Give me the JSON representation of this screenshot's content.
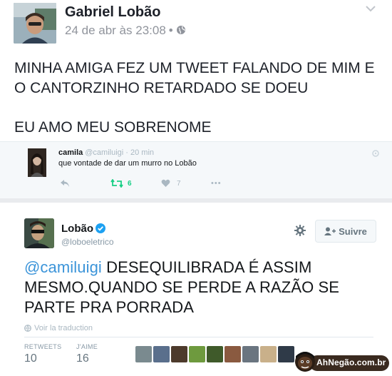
{
  "post": {
    "author": "Gabriel Lobão",
    "timestamp": "24 de abr às 23:08",
    "separator": "•",
    "body_line1": "MINHA AMIGA FEZ UM TWEET FALANDO DE MIM E",
    "body_line2": "O CANTORZINHO RETARDADO SE DOEU",
    "body_line3": "EU AMO MEU SOBRENOME"
  },
  "tweet1": {
    "name": "camila",
    "handle": "@camiluigi · 20 min",
    "text": "que vontade de dar um murro no Lobão",
    "retweets": "6",
    "likes": "7",
    "more": "•••"
  },
  "tweet2": {
    "name": "Lobão",
    "handle": "@loboeletrico",
    "follow_label": "Suivre",
    "mention": "@camiluigi",
    "text_rest": " DESEQUILIBRADA É ASSIM MESMO.QUANDO SE PERDE A RAZÃO SE PARTE PRA PORRADA",
    "translate_label": "Voir la traduction",
    "retweets_label": "RETWEETS",
    "retweets_value": "10",
    "likes_label": "J'AIME",
    "likes_value": "16"
  },
  "likers": [
    "#7a8a8f",
    "#5a6f8c",
    "#4d3a2c",
    "#6e9a3e",
    "#3f5a2a",
    "#8a5a40",
    "#6a7580",
    "#c9b08a",
    "#2f3a48"
  ],
  "watermark": {
    "text": "AhNegão.com.br"
  },
  "colors": {
    "mention": "#3b94d9",
    "retweet_green": "#19cf86",
    "meta_gray": "#90949c",
    "tweet_gray": "#aab8c2"
  }
}
